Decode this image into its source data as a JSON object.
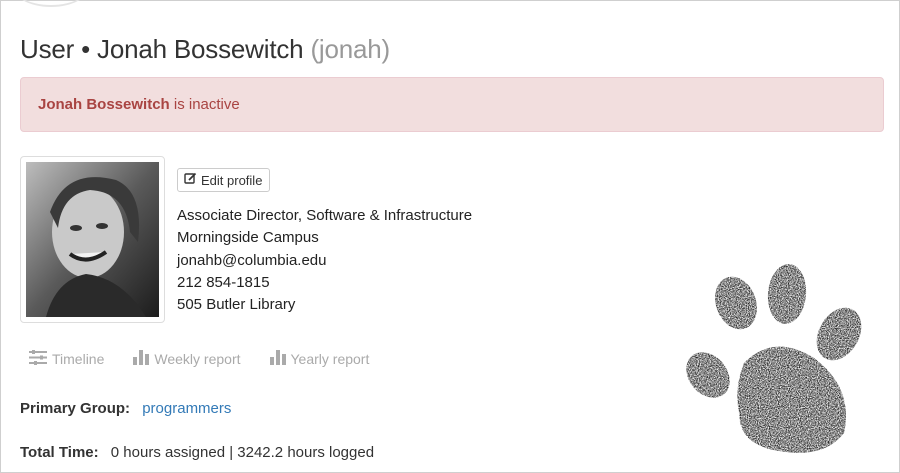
{
  "header": {
    "prefix": "User • Jonah Bossewitch",
    "username": "(jonah)"
  },
  "alert": {
    "name": "Jonah Bossewitch",
    "text": " is inactive"
  },
  "profile": {
    "edit_label": "Edit profile",
    "title": "Associate Director, Software & Infrastructure",
    "campus": "Morningside Campus",
    "email": "jonahb@columbia.edu",
    "phone": "212 854-1815",
    "office": "505 Butler Library"
  },
  "tabs": [
    {
      "label": "Timeline",
      "icon": "timeline-icon"
    },
    {
      "label": "Weekly report",
      "icon": "bar-chart-icon"
    },
    {
      "label": "Yearly report",
      "icon": "bar-chart-icon"
    }
  ],
  "primary_group": {
    "label": "Primary Group:",
    "value": "programmers"
  },
  "total_time": {
    "label": "Total Time:",
    "value": "0 hours assigned | 3242.2 hours logged"
  },
  "colors": {
    "alert_bg": "#f2dede",
    "alert_text": "#a94442",
    "link": "#337ab7",
    "muted": "#aaaaaa"
  }
}
